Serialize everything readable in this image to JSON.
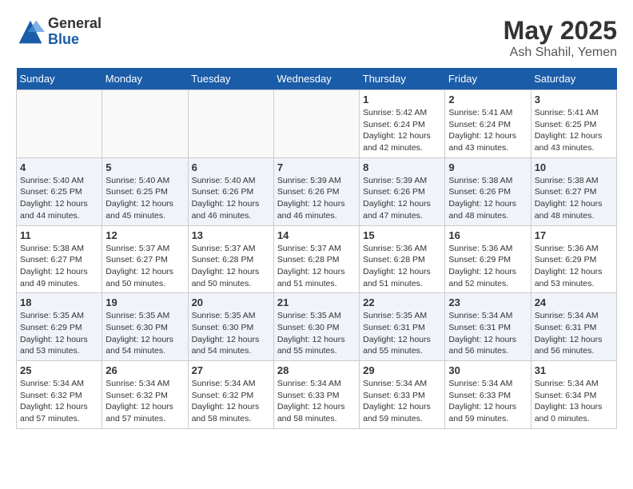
{
  "header": {
    "logo_general": "General",
    "logo_blue": "Blue",
    "month_title": "May 2025",
    "location": "Ash Shahil, Yemen"
  },
  "days_of_week": [
    "Sunday",
    "Monday",
    "Tuesday",
    "Wednesday",
    "Thursday",
    "Friday",
    "Saturday"
  ],
  "weeks": [
    [
      {
        "day": "",
        "info": ""
      },
      {
        "day": "",
        "info": ""
      },
      {
        "day": "",
        "info": ""
      },
      {
        "day": "",
        "info": ""
      },
      {
        "day": "1",
        "sunrise": "5:42 AM",
        "sunset": "6:24 PM",
        "daylight": "12 hours and 42 minutes."
      },
      {
        "day": "2",
        "sunrise": "5:41 AM",
        "sunset": "6:24 PM",
        "daylight": "12 hours and 43 minutes."
      },
      {
        "day": "3",
        "sunrise": "5:41 AM",
        "sunset": "6:25 PM",
        "daylight": "12 hours and 43 minutes."
      }
    ],
    [
      {
        "day": "4",
        "sunrise": "5:40 AM",
        "sunset": "6:25 PM",
        "daylight": "12 hours and 44 minutes."
      },
      {
        "day": "5",
        "sunrise": "5:40 AM",
        "sunset": "6:25 PM",
        "daylight": "12 hours and 45 minutes."
      },
      {
        "day": "6",
        "sunrise": "5:40 AM",
        "sunset": "6:26 PM",
        "daylight": "12 hours and 46 minutes."
      },
      {
        "day": "7",
        "sunrise": "5:39 AM",
        "sunset": "6:26 PM",
        "daylight": "12 hours and 46 minutes."
      },
      {
        "day": "8",
        "sunrise": "5:39 AM",
        "sunset": "6:26 PM",
        "daylight": "12 hours and 47 minutes."
      },
      {
        "day": "9",
        "sunrise": "5:38 AM",
        "sunset": "6:26 PM",
        "daylight": "12 hours and 48 minutes."
      },
      {
        "day": "10",
        "sunrise": "5:38 AM",
        "sunset": "6:27 PM",
        "daylight": "12 hours and 48 minutes."
      }
    ],
    [
      {
        "day": "11",
        "sunrise": "5:38 AM",
        "sunset": "6:27 PM",
        "daylight": "12 hours and 49 minutes."
      },
      {
        "day": "12",
        "sunrise": "5:37 AM",
        "sunset": "6:27 PM",
        "daylight": "12 hours and 50 minutes."
      },
      {
        "day": "13",
        "sunrise": "5:37 AM",
        "sunset": "6:28 PM",
        "daylight": "12 hours and 50 minutes."
      },
      {
        "day": "14",
        "sunrise": "5:37 AM",
        "sunset": "6:28 PM",
        "daylight": "12 hours and 51 minutes."
      },
      {
        "day": "15",
        "sunrise": "5:36 AM",
        "sunset": "6:28 PM",
        "daylight": "12 hours and 51 minutes."
      },
      {
        "day": "16",
        "sunrise": "5:36 AM",
        "sunset": "6:29 PM",
        "daylight": "12 hours and 52 minutes."
      },
      {
        "day": "17",
        "sunrise": "5:36 AM",
        "sunset": "6:29 PM",
        "daylight": "12 hours and 53 minutes."
      }
    ],
    [
      {
        "day": "18",
        "sunrise": "5:35 AM",
        "sunset": "6:29 PM",
        "daylight": "12 hours and 53 minutes."
      },
      {
        "day": "19",
        "sunrise": "5:35 AM",
        "sunset": "6:30 PM",
        "daylight": "12 hours and 54 minutes."
      },
      {
        "day": "20",
        "sunrise": "5:35 AM",
        "sunset": "6:30 PM",
        "daylight": "12 hours and 54 minutes."
      },
      {
        "day": "21",
        "sunrise": "5:35 AM",
        "sunset": "6:30 PM",
        "daylight": "12 hours and 55 minutes."
      },
      {
        "day": "22",
        "sunrise": "5:35 AM",
        "sunset": "6:31 PM",
        "daylight": "12 hours and 55 minutes."
      },
      {
        "day": "23",
        "sunrise": "5:34 AM",
        "sunset": "6:31 PM",
        "daylight": "12 hours and 56 minutes."
      },
      {
        "day": "24",
        "sunrise": "5:34 AM",
        "sunset": "6:31 PM",
        "daylight": "12 hours and 56 minutes."
      }
    ],
    [
      {
        "day": "25",
        "sunrise": "5:34 AM",
        "sunset": "6:32 PM",
        "daylight": "12 hours and 57 minutes."
      },
      {
        "day": "26",
        "sunrise": "5:34 AM",
        "sunset": "6:32 PM",
        "daylight": "12 hours and 57 minutes."
      },
      {
        "day": "27",
        "sunrise": "5:34 AM",
        "sunset": "6:32 PM",
        "daylight": "12 hours and 58 minutes."
      },
      {
        "day": "28",
        "sunrise": "5:34 AM",
        "sunset": "6:33 PM",
        "daylight": "12 hours and 58 minutes."
      },
      {
        "day": "29",
        "sunrise": "5:34 AM",
        "sunset": "6:33 PM",
        "daylight": "12 hours and 59 minutes."
      },
      {
        "day": "30",
        "sunrise": "5:34 AM",
        "sunset": "6:33 PM",
        "daylight": "12 hours and 59 minutes."
      },
      {
        "day": "31",
        "sunrise": "5:34 AM",
        "sunset": "6:34 PM",
        "daylight": "13 hours and 0 minutes."
      }
    ]
  ],
  "labels": {
    "sunrise": "Sunrise:",
    "sunset": "Sunset:",
    "daylight": "Daylight:"
  }
}
